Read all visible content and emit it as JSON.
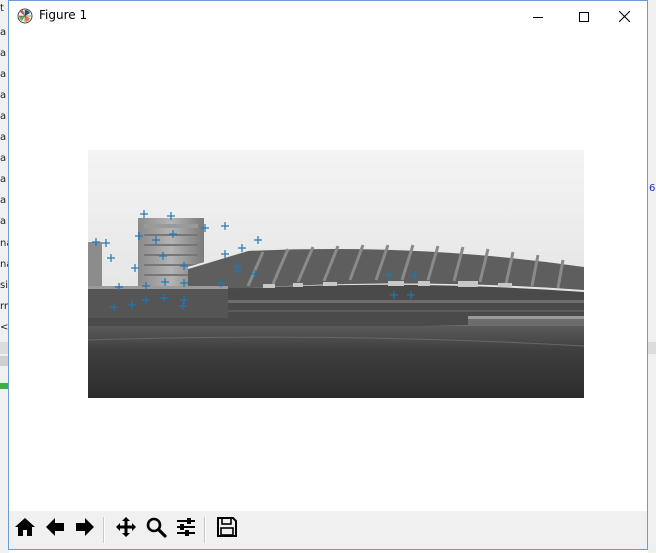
{
  "window": {
    "title": "Figure 1",
    "app_icon": "matplotlib-logo-icon",
    "controls": [
      "minimize-icon",
      "maximize-icon",
      "close-icon"
    ]
  },
  "figure": {
    "content": "grayscale stadium photograph with blue '+' keypoint markers",
    "marker_color": "#1f77b4",
    "marker_symbol": "+"
  },
  "background_fragments": {
    "left": [
      "t",
      "a",
      "a",
      "a",
      "a",
      "a",
      "a",
      "a",
      "a",
      "a",
      "a",
      "na",
      "na",
      "sit",
      "rr",
      "<"
    ],
    "right": "6"
  },
  "toolbar": {
    "buttons": [
      {
        "name": "home-button",
        "icon": "home-icon"
      },
      {
        "name": "back-button",
        "icon": "arrow-left-icon"
      },
      {
        "name": "forward-button",
        "icon": "arrow-right-icon"
      },
      {
        "name": "pan-button",
        "icon": "move-icon"
      },
      {
        "name": "zoom-button",
        "icon": "magnifier-icon"
      },
      {
        "name": "configure-subplots-button",
        "icon": "sliders-icon"
      },
      {
        "name": "save-button",
        "icon": "floppy-disk-icon"
      }
    ]
  }
}
